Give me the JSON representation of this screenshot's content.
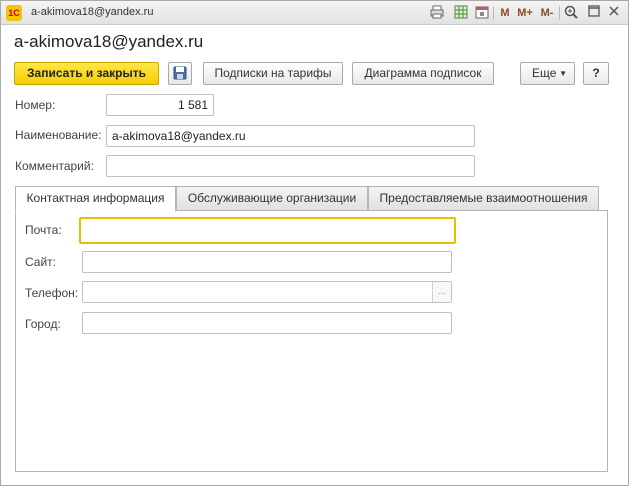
{
  "window": {
    "title": "a-akimova18@yandex.ru",
    "logo_text": "1С",
    "toolbar": {
      "m_label": "M",
      "m_plus_label": "M+",
      "m_minus_label": "M-"
    }
  },
  "form": {
    "title": "a-akimova18@yandex.ru",
    "buttons": {
      "save_close": "Записать и закрыть",
      "subscriptions": "Подписки на тарифы",
      "diagram": "Диаграмма подписок",
      "more": "Еще",
      "help": "?"
    },
    "fields": {
      "number_label": "Номер:",
      "number_value": "1 581",
      "name_label": "Наименование:",
      "name_value": "a-akimova18@yandex.ru",
      "comment_label": "Комментарий:",
      "comment_value": ""
    }
  },
  "tabs": {
    "items": [
      {
        "label": "Контактная информация"
      },
      {
        "label": "Обслуживающие организации"
      },
      {
        "label": "Предоставляемые взаимоотношения"
      }
    ],
    "active": 0
  },
  "contact": {
    "email_label": "Почта:",
    "email_value": "",
    "site_label": "Сайт:",
    "site_value": "",
    "phone_label": "Телефон:",
    "phone_value": "",
    "phone_select": "...",
    "city_label": "Город:",
    "city_value": ""
  },
  "colors": {
    "accent": "#f5cf00",
    "focus_border": "#e6c000"
  }
}
